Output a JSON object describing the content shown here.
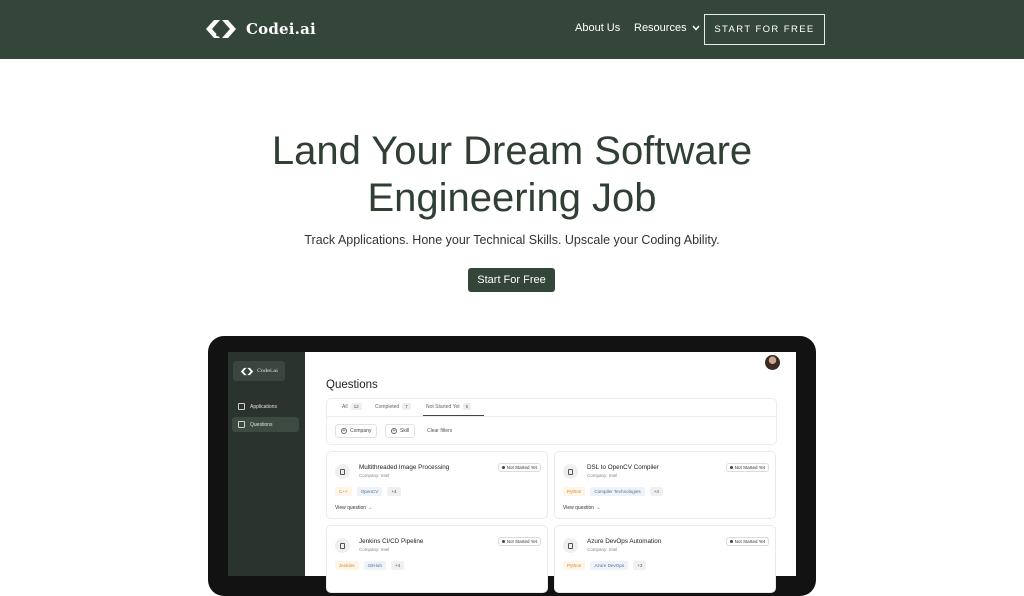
{
  "nav": {
    "brand": "Codei.ai",
    "links": [
      "About Us",
      "Resources"
    ],
    "resources_caret": "⌄",
    "cta": "START FOR FREE"
  },
  "hero": {
    "title_line1": "Land Your Dream Software",
    "title_line2": "Engineering Job",
    "subtitle": "Track Applications. Hone your Technical Skills. Upscale your Coding Ability.",
    "cta": "Start For Free"
  },
  "app": {
    "brand": "Codei.ai",
    "sidebar": [
      {
        "label": "Applications",
        "active": false
      },
      {
        "label": "Questions",
        "active": true
      }
    ],
    "page_title": "Questions",
    "tabs": [
      {
        "label": "All",
        "count": "12"
      },
      {
        "label": "Completed",
        "count": "7"
      },
      {
        "label": "Not Started Yet",
        "count": "5"
      }
    ],
    "filters": {
      "company": "Company",
      "skill": "Skill",
      "clear": "Clear filters"
    },
    "cards": [
      {
        "title": "Multithreaded Image Processing",
        "company": "Company: Intel",
        "status": "Not Started Yet",
        "tags": [
          "C++",
          "OpenCV",
          "+4"
        ],
        "link": "View question →"
      },
      {
        "title": "DSL to OpenCV Compiler",
        "company": "Company: Intel",
        "status": "Not Started Yet",
        "tags": [
          "Python",
          "Compiler Technologies",
          "+4"
        ],
        "link": "View question →"
      },
      {
        "title": "Jenkins CI/CD Pipeline",
        "company": "Company: Intel",
        "status": "Not Started Yet",
        "tags": [
          "Jenkins",
          "GitHub",
          "+4"
        ],
        "link": ""
      },
      {
        "title": "Azure DevOps Automation",
        "company": "Company: Intel",
        "status": "Not Started Yet",
        "tags": [
          "Python",
          "Azure DevOps",
          "+3"
        ],
        "link": ""
      }
    ]
  },
  "colors": {
    "nav_bg": "#34463a",
    "accent": "#34463a",
    "title": "#2f3f34"
  }
}
